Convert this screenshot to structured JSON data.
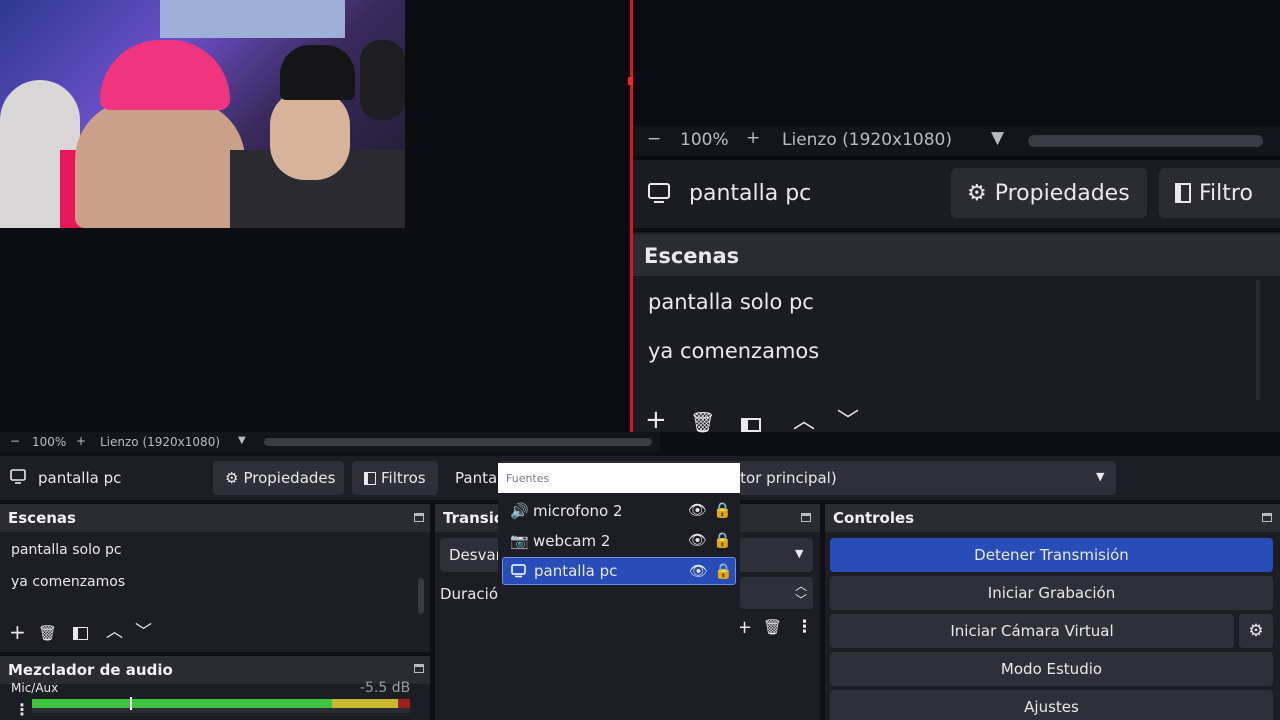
{
  "nested": {
    "zoom": "100%",
    "canvas": "Lienzo (1920x1080)",
    "source_name": "pantalla pc",
    "properties_label": "Propiedades",
    "filters_label": "Filtro",
    "scenes_title": "Escenas",
    "scenes": [
      "pantalla solo pc",
      "ya comenzamos"
    ]
  },
  "zoombar": {
    "zoom": "100%",
    "canvas": "Lienzo (1920x1080)"
  },
  "sourcebar": {
    "source_name": "pantalla pc",
    "properties_label": "Propiedades",
    "filters_label": "Filtros",
    "display_label": "Pantal",
    "display_value": "itor principal)"
  },
  "scenes": {
    "title": "Escenas",
    "items": [
      "pantalla solo pc",
      "ya comenzamos"
    ]
  },
  "transitions": {
    "title": "Transic",
    "type": "Desvan",
    "duration_label": "Duración"
  },
  "mixer": {
    "title": "Mezclador de audio",
    "channel": "Mic/Aux",
    "level": "-5.5 dB"
  },
  "fuentes": {
    "title": "Fuentes",
    "items": [
      {
        "name": "microfono 2",
        "icon": "speaker-icon",
        "selected": false
      },
      {
        "name": "webcam 2",
        "icon": "camera-icon",
        "selected": false
      },
      {
        "name": "pantalla pc",
        "icon": "monitor-icon",
        "selected": true
      }
    ]
  },
  "controls": {
    "title": "Controles",
    "stop_stream": "Detener Transmisión",
    "start_recording": "Iniciar Grabación",
    "virtual_cam": "Iniciar Cámara Virtual",
    "studio_mode": "Modo Estudio",
    "settings": "Ajustes"
  },
  "colors": {
    "accent": "#284cb8",
    "live_line": "#e0141e",
    "meter_green": "#3ec43e",
    "meter_yellow": "#c9b92e",
    "meter_red": "#9e1f1f"
  }
}
